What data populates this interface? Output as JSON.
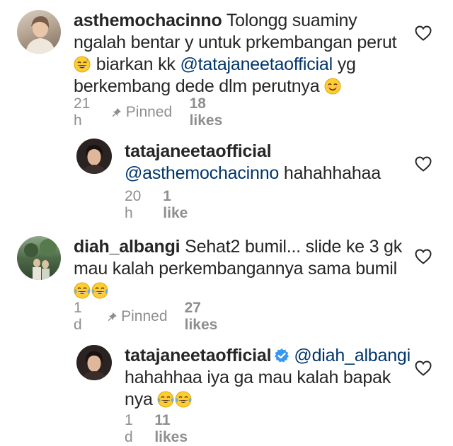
{
  "comments": [
    {
      "username": "asthemochacinno",
      "text_line1": "Tolongg suaminy",
      "text_line2": "ngalah bentar y untuk prkembangan perut",
      "text_line3_pre": "biarkan kk",
      "mention": "@tatajaneetaofficial",
      "text_line3_post": "yg",
      "text_line4": "berkembang dede dlm perutnya",
      "time": "21 h",
      "pinned": "Pinned",
      "likes": "18 likes"
    },
    {
      "username": "tatajaneetaofficial",
      "mention": "@asthemochacinno",
      "text": "hahahhahaa",
      "time": "20 h",
      "likes": "1 like"
    },
    {
      "username": "diah_albangi",
      "text_line1": "Sehat2 bumil... slide ke 3 gk",
      "text_line2": "mau kalah perkembangannya sama bumil",
      "time": "1 d",
      "pinned": "Pinned",
      "likes": "27 likes"
    },
    {
      "username": "tatajaneetaofficial",
      "mention": "@diah_albangi",
      "text_line2": "hahahhaa iya ga mau kalah bapak",
      "text_line3": "nya",
      "time": "1 d",
      "likes": "11 likes"
    }
  ],
  "icons": {
    "heart": "heart-outline-icon",
    "pin": "pin-icon",
    "verified": "verified-badge-icon",
    "emoji_grin": "grinning-sweat-emoji",
    "emoji_smile": "smiling-emoji",
    "emoji_cry": "tears-of-joy-emoji"
  },
  "colors": {
    "text": "#262626",
    "meta": "#8e8e8e",
    "mention": "#003569",
    "verified": "#3897f0"
  }
}
